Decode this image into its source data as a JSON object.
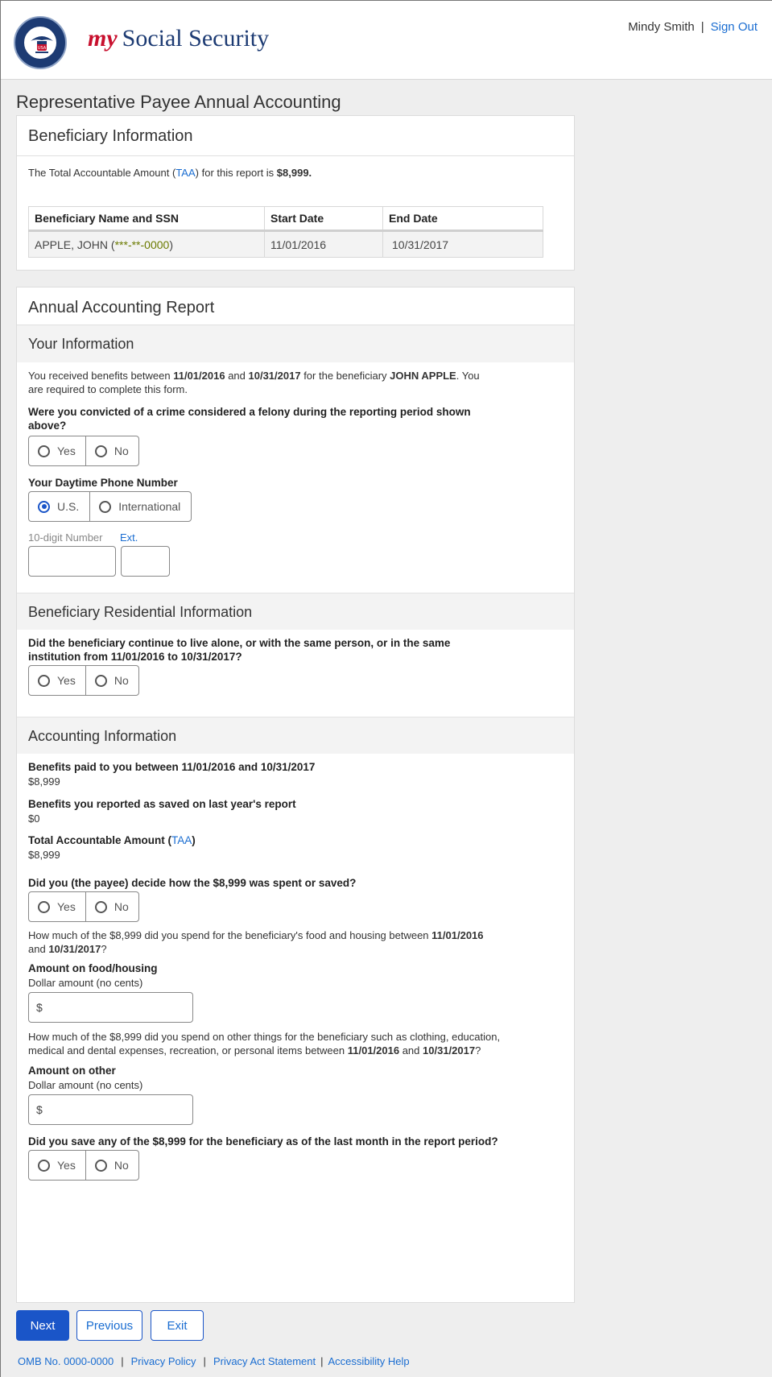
{
  "header": {
    "brand_my": "my",
    "brand_name": "Social Security",
    "user_name": "Mindy Smith",
    "separator": "|",
    "sign_out": "Sign Out",
    "seal_text": "USA"
  },
  "page_title": "Representative Payee Annual Accounting",
  "beneficiary_panel": {
    "title": "Beneficiary Information",
    "taa_prefix": "The Total Accountable Amount (",
    "taa_link": "TAA",
    "taa_suffix": ") for this report is ",
    "taa_amount": "$8,999.",
    "table": {
      "headers": [
        "Beneficiary Name and SSN",
        "Start Date",
        "End Date"
      ],
      "row": {
        "name": "APPLE, JOHN (",
        "ssn": "***-**-0000",
        "name_close": ")",
        "start": "11/01/2016",
        "end": "10/31/2017"
      }
    }
  },
  "report_panel": {
    "title": "Annual Accounting Report",
    "your_info": {
      "heading": "Your Information",
      "intro_1": "You received benefits between ",
      "date_start": "11/01/2016",
      "intro_and": " and ",
      "date_end": "10/31/2017",
      "intro_2": " for the beneficiary ",
      "beneficiary": "JOHN APPLE",
      "intro_3": ". You",
      "intro_line2": "are required to complete this form.",
      "felony_q_line1": "Were you convicted of a crime considered a felony during the reporting period shown",
      "felony_q_line2": "above?",
      "yes": "Yes",
      "no": "No",
      "phone_label": "Your Daytime Phone Number",
      "phone_us": "U.S.",
      "phone_intl": "International",
      "phone_number_label": "10-digit Number",
      "phone_ext_label": "Ext."
    },
    "residential": {
      "heading": "Beneficiary Residential Information",
      "q_line1": "Did the beneficiary continue to live alone, or with the same person, or in the same",
      "q_line2": "institution from 11/01/2016 to 10/31/2017?",
      "yes": "Yes",
      "no": "No"
    },
    "accounting": {
      "heading": "Accounting Information",
      "benefits_paid_label": "Benefits paid to you between 11/01/2016 and 10/31/2017",
      "benefits_paid_value": "$8,999",
      "saved_label": "Benefits you reported as saved on last year's report",
      "saved_value": "$0",
      "taa_label_prefix": "Total Accountable Amount (",
      "taa_link": "TAA",
      "taa_label_suffix": ")",
      "taa_value": "$8,999",
      "decide_q": "Did you (the payee) decide how the $8,999 was spent or saved?",
      "yes": "Yes",
      "no": "No",
      "food_q_1": "How much of the $8,999 did you spend for the beneficiary's food and housing between ",
      "food_q_date1": "11/01/2016",
      "food_q_and": "and ",
      "food_q_date2": "10/31/2017",
      "food_q_end": "?",
      "food_label": "Amount on food/housing",
      "food_sub": "Dollar amount (no cents)",
      "food_prefix": "$",
      "other_q_line1": "How much of the $8,999 did you spend on other things for the beneficiary such as clothing, education,",
      "other_q_line2a": "medical and dental expenses, recreation, or personal items between ",
      "other_q_date1": "11/01/2016",
      "other_q_and": " and ",
      "other_q_date2": "10/31/2017",
      "other_q_end": "?",
      "other_label": "Amount on other",
      "other_sub": "Dollar amount (no cents)",
      "other_prefix": "$",
      "save_q": "Did you save any of the $8,999 for the beneficiary as of the last month in the report period?",
      "save_yes": "Yes",
      "save_no": "No"
    }
  },
  "buttons": {
    "next": "Next",
    "previous": "Previous",
    "exit": "Exit"
  },
  "footer": {
    "omb": "OMB No. 0000-0000",
    "sep": "|",
    "privacy_policy": "Privacy Policy",
    "privacy_act": "Privacy Act Statement",
    "accessibility": "Accessibility Help"
  }
}
